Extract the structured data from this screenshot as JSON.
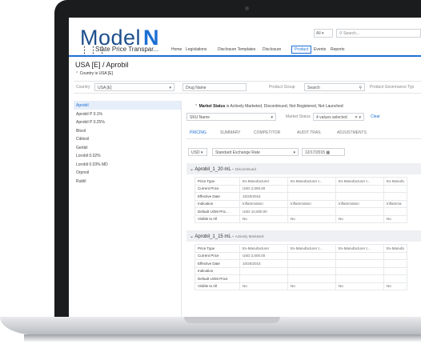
{
  "app": {
    "logo_main": "Model",
    "logo_accent": "N",
    "name": "State Price Transpar..."
  },
  "header": {
    "global_selector": "All",
    "search_placeholder": "Search..."
  },
  "nav": {
    "items": [
      "Home",
      "Legislations",
      "Disclosure Templates",
      "Disclosure",
      "Product",
      "Events",
      "Reports"
    ],
    "active": "Product"
  },
  "record": {
    "title": "USA [E] / Aprobil",
    "breadcrumb": "Country is USA [E]"
  },
  "filters": {
    "country_label": "Country",
    "country_value": "USA [E]",
    "drug_name_label": "Drug Name",
    "product_group_label": "Product Group",
    "product_group_value": "Search",
    "product_governance_label": "Product Governance Typ"
  },
  "drug_list": [
    "Aprobil",
    "Aprobil P 0.1%",
    "Aprobil P 0.25%",
    "Bloxil",
    "Cibloxil",
    "Genbil",
    "Lorobil 0.02%",
    "Lorobil 0.03% MD",
    "Orpnoil",
    "Rublil"
  ],
  "selected_drug": "Aprobil",
  "market_status": {
    "label": "Market Status",
    "text": "is Actively Marketed, Discontinued, Not Registered, Not Launched",
    "sku_placeholder": "SKU Name",
    "status_label": "Market Status",
    "status_value": "4 values selected",
    "clear": "Clear"
  },
  "tabs": [
    "PRICING",
    "SUMMARY",
    "COMPETITOR",
    "AUDIT TRAIL",
    "ADJUSTMENTS"
  ],
  "active_tab": "PRICING",
  "toolbar": {
    "currency": "USD",
    "rate": "Standard Exchange Rate",
    "date": "12/17/2015"
  },
  "groups": [
    {
      "title": "Aprobil_1_20 mL",
      "status": "Discontinued",
      "rows": [
        [
          "Price Type",
          "Ex-Manufacturer",
          "Ex-Manufacturer t...",
          "Ex-Manufacturer t...",
          "Ex-Manufa"
        ],
        [
          "Current Price",
          "USD 2,000.00",
          "",
          "",
          ""
        ],
        [
          "Effective Date",
          "10/20/2015",
          "",
          "",
          ""
        ],
        [
          "Indication",
          "Inflammation",
          "Inflammation",
          "Inflammation",
          "Inflamma"
        ],
        [
          "Default UOM Pric...",
          "USD 10,000.00",
          "",
          "",
          ""
        ],
        [
          "Visible to All",
          "No",
          "No",
          "No",
          "No"
        ]
      ]
    },
    {
      "title": "Aprobil_1_15 mL",
      "status": "Actively Marketed",
      "rows": [
        [
          "Price Type",
          "Ex-Manufacturer",
          "Ex-Manufacturer t...",
          "Ex-Manufacturer t...",
          "Ex-Manufa"
        ],
        [
          "Current Price",
          "USD 2,000.00",
          "",
          "",
          ""
        ],
        [
          "Effective Date",
          "10/20/2015",
          "",
          "",
          ""
        ],
        [
          "Indication",
          "",
          "",
          "",
          ""
        ],
        [
          "Default UOM Price",
          "",
          "",
          "",
          ""
        ],
        [
          "Visible to All",
          "No",
          "No",
          "No",
          "No"
        ]
      ]
    }
  ]
}
